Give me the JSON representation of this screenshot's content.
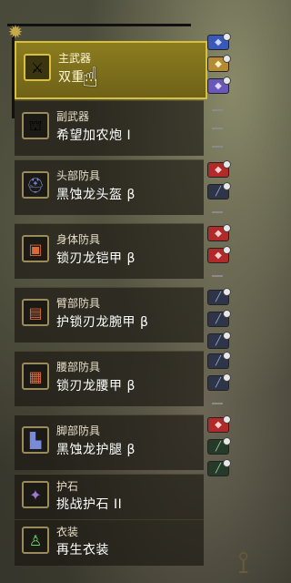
{
  "slots": [
    {
      "category": "主武器",
      "name": "双重...",
      "icon": "great-sword-icon",
      "selected": true
    },
    {
      "category": "副武器",
      "name": "希望加农炮 I",
      "icon": "cannon-icon",
      "selected": false
    },
    {
      "category": "头部防具",
      "name": "黑蚀龙头盔 β",
      "icon": "helmet-icon",
      "selected": false
    },
    {
      "category": "身体防具",
      "name": "锁刃龙铠甲 β",
      "icon": "chest-armor-icon",
      "selected": false
    },
    {
      "category": "臂部防具",
      "name": "护锁刃龙腕甲 β",
      "icon": "gauntlet-icon",
      "selected": false
    },
    {
      "category": "腰部防具",
      "name": "锁刃龙腰甲 β",
      "icon": "waist-armor-icon",
      "selected": false
    },
    {
      "category": "脚部防具",
      "name": "黑蚀龙护腿 β",
      "icon": "greaves-icon",
      "selected": false
    },
    {
      "category": "护石",
      "name": "挑战护石 II",
      "icon": "talisman-icon",
      "selected": false
    },
    {
      "category": "衣装",
      "name": "再生衣装",
      "icon": "mantle-icon",
      "selected": false
    }
  ],
  "decorations": [
    [
      "blue",
      "gold",
      "purple"
    ],
    [
      "empty",
      "empty",
      "empty"
    ],
    [
      "red",
      "slate",
      "empty"
    ],
    [
      "red",
      "red",
      "empty"
    ],
    [
      "slate",
      "slate",
      "slate"
    ],
    [
      "slate",
      "slate",
      "empty"
    ],
    [
      "red",
      "green",
      "green"
    ]
  ],
  "colors": {
    "selected_bg": "#8c7c1f",
    "selected_border": "#d8c03a",
    "deco_blue": "#3a58b8",
    "deco_gold": "#b48a35",
    "deco_purple": "#6a58b8",
    "deco_red": "#b02a2a",
    "deco_slate": "#2f3548",
    "deco_green": "#263a2a"
  }
}
